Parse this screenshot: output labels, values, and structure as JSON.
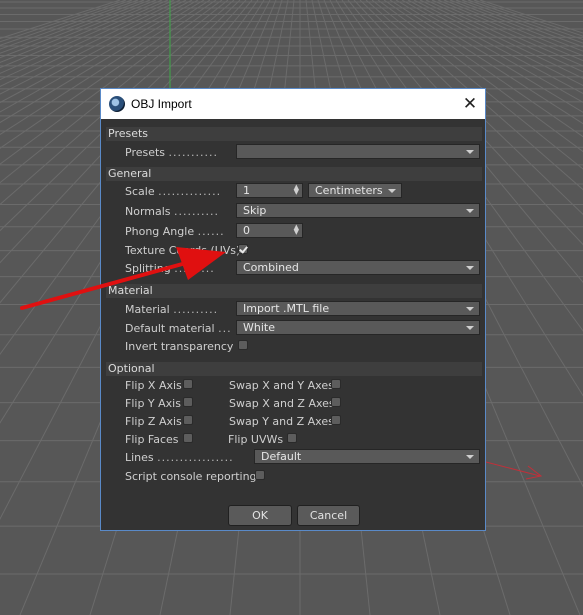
{
  "dialog": {
    "title": "OBJ Import",
    "close_glyph": "✕"
  },
  "presets": {
    "section": "Presets",
    "label": "Presets",
    "value": ""
  },
  "general": {
    "section": "General",
    "scale_label": "Scale",
    "scale_value": "1",
    "scale_unit": "Centimeters",
    "normals_label": "Normals",
    "normals_value": "Skip",
    "phong_label": "Phong Angle",
    "phong_value": "0",
    "texture_label": "Texture Coords (UVs)",
    "texture_checked": true,
    "splitting_label": "Splitting",
    "splitting_value": "Combined"
  },
  "material": {
    "section": "Material",
    "material_label": "Material",
    "material_value": "Import .MTL file",
    "default_label": "Default material",
    "default_value": "White",
    "invert_label": "Invert transparency",
    "invert_checked": false
  },
  "optional": {
    "section": "Optional",
    "flip_x": "Flip X Axis",
    "flip_y": "Flip Y Axis",
    "flip_z": "Flip Z Axis",
    "flip_faces": "Flip Faces",
    "swap_xy": "Swap X and Y Axes",
    "swap_xz": "Swap X and Z Axes",
    "swap_yz": "Swap Y and Z Axes",
    "flip_uvws": "Flip UVWs",
    "lines_label": "Lines",
    "lines_value": "Default",
    "script_console": "Script console reporting"
  },
  "buttons": {
    "ok": "OK",
    "cancel": "Cancel"
  },
  "colors": {
    "viewport_bg": "#575757",
    "dialog_bg": "#333333",
    "accent_border": "#5a8ac8",
    "annotation_arrow": "#e01010",
    "axis_x": "#c0303a",
    "axis_y": "#3fa84a"
  },
  "icons": {
    "app": "cinema4d-logo-icon",
    "close": "close-icon",
    "dropdown": "chevron-down-icon",
    "spinner": "spinner-arrows-icon",
    "annotation": "red-arrow-icon"
  }
}
